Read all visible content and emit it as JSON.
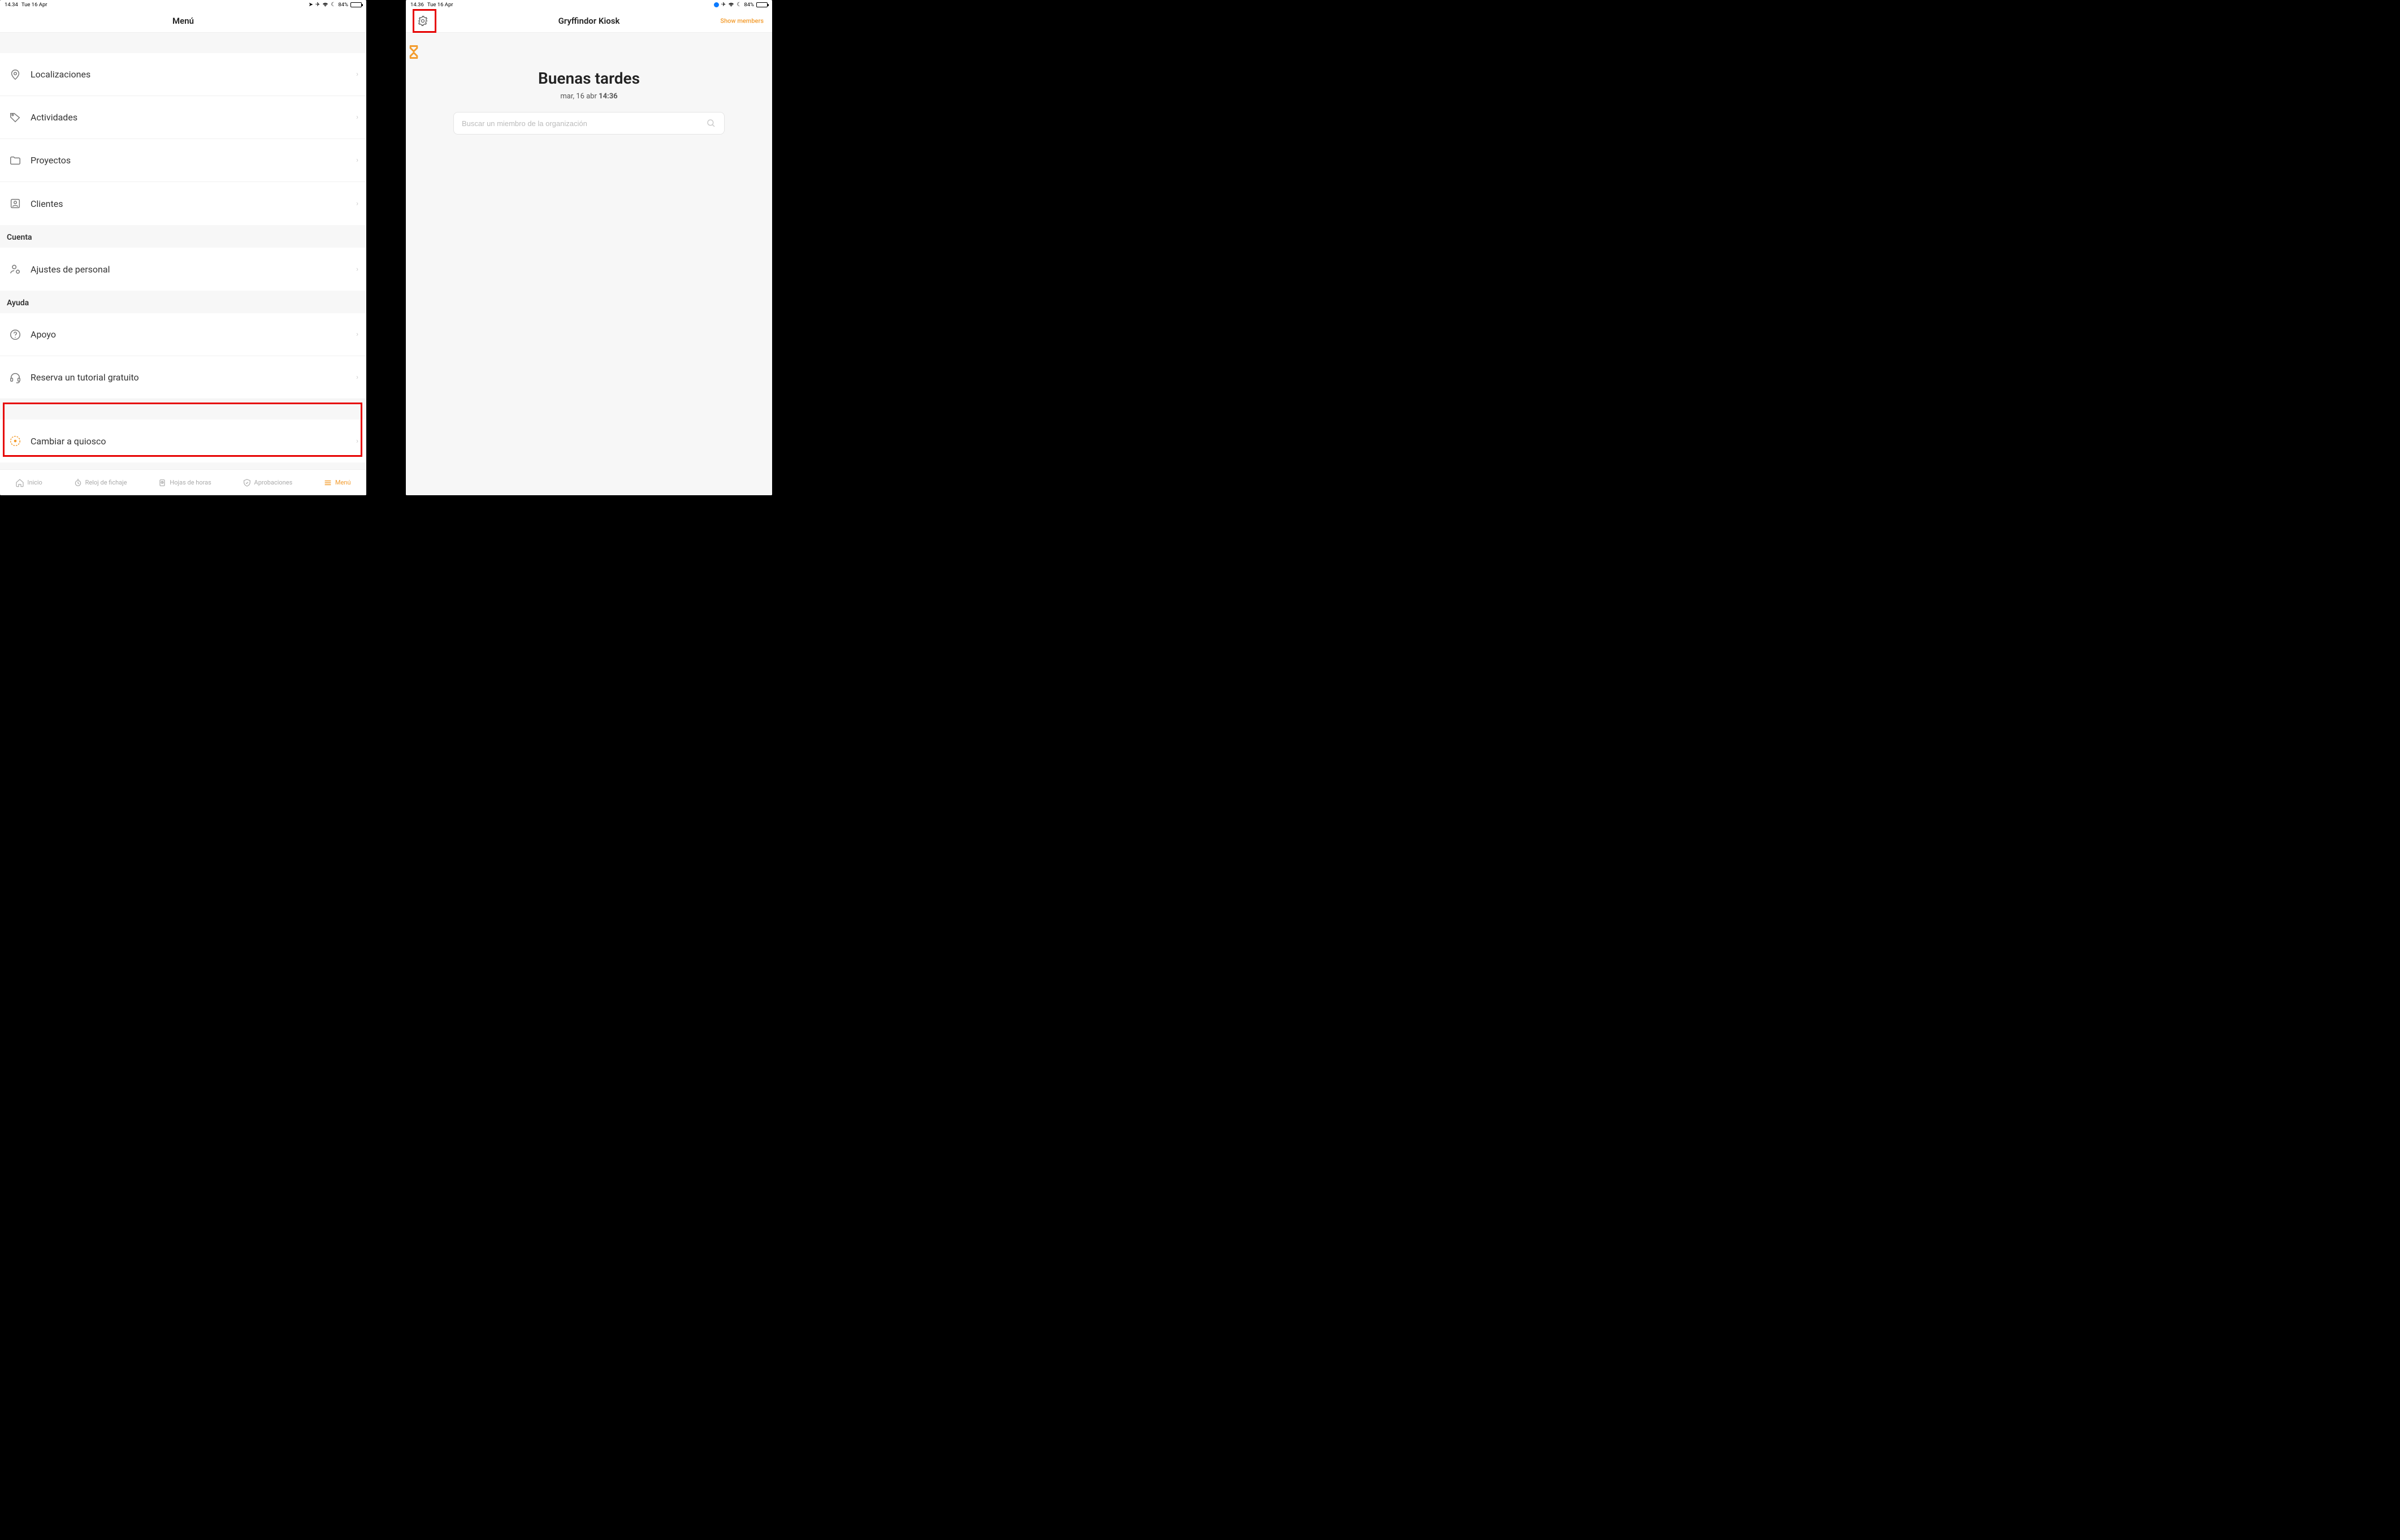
{
  "left": {
    "status": {
      "time": "14.34",
      "date": "Tue 16 Apr",
      "battery": "84%"
    },
    "header": {
      "title": "Menú"
    },
    "menu_top": [
      {
        "key": "locations",
        "label": "Localizaciones",
        "icon": "pin-icon"
      },
      {
        "key": "activities",
        "label": "Actividades",
        "icon": "tag-icon"
      },
      {
        "key": "projects",
        "label": "Proyectos",
        "icon": "folder-icon"
      },
      {
        "key": "clients",
        "label": "Clientes",
        "icon": "contacts-icon"
      }
    ],
    "sections": {
      "account": {
        "title": "Cuenta",
        "items": [
          {
            "key": "personal-settings",
            "label": "Ajustes de personal",
            "icon": "user-gear-icon"
          }
        ]
      },
      "help": {
        "title": "Ayuda",
        "items": [
          {
            "key": "support",
            "label": "Apoyo",
            "icon": "help-circle-icon"
          },
          {
            "key": "tutorial",
            "label": "Reserva un tutorial gratuito",
            "icon": "headset-icon"
          },
          {
            "key": "kiosk-switch",
            "label": "Cambiar a quiosco",
            "icon": "kiosk-icon",
            "highlighted": true
          }
        ]
      }
    },
    "tabs": [
      {
        "key": "home",
        "label": "Inicio",
        "icon": "home-icon"
      },
      {
        "key": "clock",
        "label": "Reloj de fichaje",
        "icon": "stopwatch-icon"
      },
      {
        "key": "timesheets",
        "label": "Hojas de horas",
        "icon": "clipboard-icon"
      },
      {
        "key": "approvals",
        "label": "Aprobaciones",
        "icon": "shield-check-icon"
      },
      {
        "key": "menu",
        "label": "Menú",
        "icon": "menu-icon",
        "active": true
      }
    ]
  },
  "right": {
    "status": {
      "time": "14.36",
      "date": "Tue 16 Apr",
      "battery": "84%"
    },
    "header": {
      "title": "Gryffindor Kiosk",
      "right_button": "Show members"
    },
    "kiosk": {
      "greeting": "Buenas tardes",
      "date_prefix": "mar, 16 abr ",
      "date_time": "14:36",
      "search_placeholder": "Buscar un miembro de la organización"
    }
  }
}
